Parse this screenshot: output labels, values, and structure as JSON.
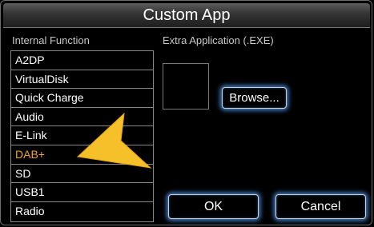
{
  "header": {
    "title": "Custom App"
  },
  "left_panel": {
    "label": "Internal Function",
    "items": [
      "A2DP",
      "VirtualDisk",
      "Quick Charge",
      "Audio",
      "E-Link",
      "DAB+",
      "SD",
      "USB1",
      "Radio"
    ],
    "selected_item": "DAB+"
  },
  "right_panel": {
    "label": "Extra Application (.EXE)"
  },
  "buttons": {
    "browse": "Browse...",
    "ok": "OK",
    "cancel": "Cancel"
  },
  "colors": {
    "selected_text": "#f0a42a",
    "button_glow": "#5096eb",
    "pointer_arrow": "#f5c02a"
  }
}
